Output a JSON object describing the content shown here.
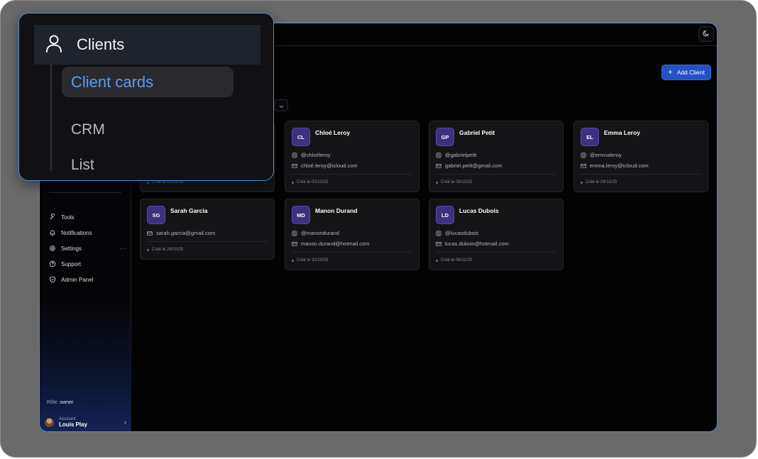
{
  "header": {
    "add_client_label": "Add Client",
    "theme_icon": "moon-icon"
  },
  "sidebar": {
    "nav": [
      {
        "label": "Tools",
        "icon": "wrench-icon"
      },
      {
        "label": "Notifications",
        "icon": "bell-icon"
      },
      {
        "label": "Settings",
        "icon": "gear-icon",
        "more": "···"
      },
      {
        "label": "Support",
        "icon": "help-icon"
      },
      {
        "label": "Admin Panel",
        "icon": "shield-icon"
      }
    ],
    "role_label": "Rôle:",
    "role_value": "owner",
    "account_label": "Account",
    "account_name": "Louis Play"
  },
  "overlay": {
    "section_title": "Clients",
    "items": [
      "Client cards",
      "CRM",
      "List"
    ]
  },
  "cards": [
    {
      "initials": "",
      "name": "",
      "email": "",
      "instagram": "",
      "date": "Créé le 02/10/25"
    },
    {
      "initials": "CL",
      "name": "Chloé Leroy",
      "instagram": "@chloéleroy",
      "email": "chloé.leroy@icloud.com",
      "date": "Créé le 03/10/25"
    },
    {
      "initials": "GP",
      "name": "Gabriel Petit",
      "instagram": "@gabrielpetit",
      "email": "gabriel.petit@gmail.com",
      "date": "Créé le 09/10/25"
    },
    {
      "initials": "EL",
      "name": "Emma Leroy",
      "instagram": "@emmaleroy",
      "email": "emma.leroy@icloud.com",
      "date": "Créé le 09/10/25"
    },
    {
      "initials": "SG",
      "name": "Sarah Garcia",
      "email": "sarah.garcia@gmail.com",
      "date": "Créé le 29/10/25"
    },
    {
      "initials": "MD",
      "name": "Manon Durand",
      "instagram": "@manondurand",
      "email": "manon.durand@hotmail.com",
      "date": "Créé le 31/10/25"
    },
    {
      "initials": "LD",
      "name": "Lucas Dubois",
      "instagram": "@lucasdubois",
      "email": "lucas.dubois@hotmail.com",
      "date": "Créé le 06/11/25"
    }
  ]
}
